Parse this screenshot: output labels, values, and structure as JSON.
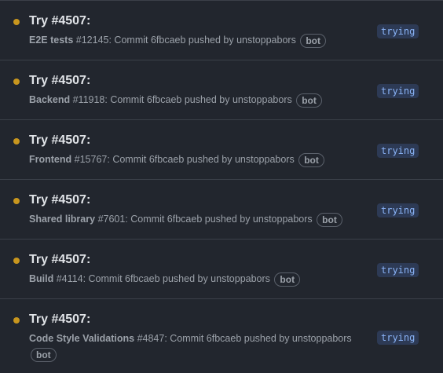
{
  "colors": {
    "dot": "#c8961e",
    "status_text": "#8ab4f8",
    "status_bg": "#2d3a55"
  },
  "runs": [
    {
      "title": "Try #4507:",
      "workflow": "E2E tests",
      "run": "#12145",
      "message": ": Commit 6fbcaeb pushed by unstoppabors",
      "badge": "bot",
      "status": "trying"
    },
    {
      "title": "Try #4507:",
      "workflow": "Backend",
      "run": "#11918",
      "message": ": Commit 6fbcaeb pushed by unstoppabors",
      "badge": "bot",
      "status": "trying"
    },
    {
      "title": "Try #4507:",
      "workflow": "Frontend",
      "run": "#15767",
      "message": ": Commit 6fbcaeb pushed by unstoppabors",
      "badge": "bot",
      "status": "trying"
    },
    {
      "title": "Try #4507:",
      "workflow": "Shared library",
      "run": "#7601",
      "message": ": Commit 6fbcaeb pushed by unstoppabors",
      "badge": "bot",
      "status": "trying"
    },
    {
      "title": "Try #4507:",
      "workflow": "Build",
      "run": "#4114",
      "message": ": Commit 6fbcaeb pushed by unstoppabors",
      "badge": "bot",
      "status": "trying"
    },
    {
      "title": "Try #4507:",
      "workflow": "Code Style Validations",
      "run": "#4847",
      "message": ": Commit 6fbcaeb pushed by unstoppabors",
      "badge": "bot",
      "status": "trying"
    }
  ]
}
